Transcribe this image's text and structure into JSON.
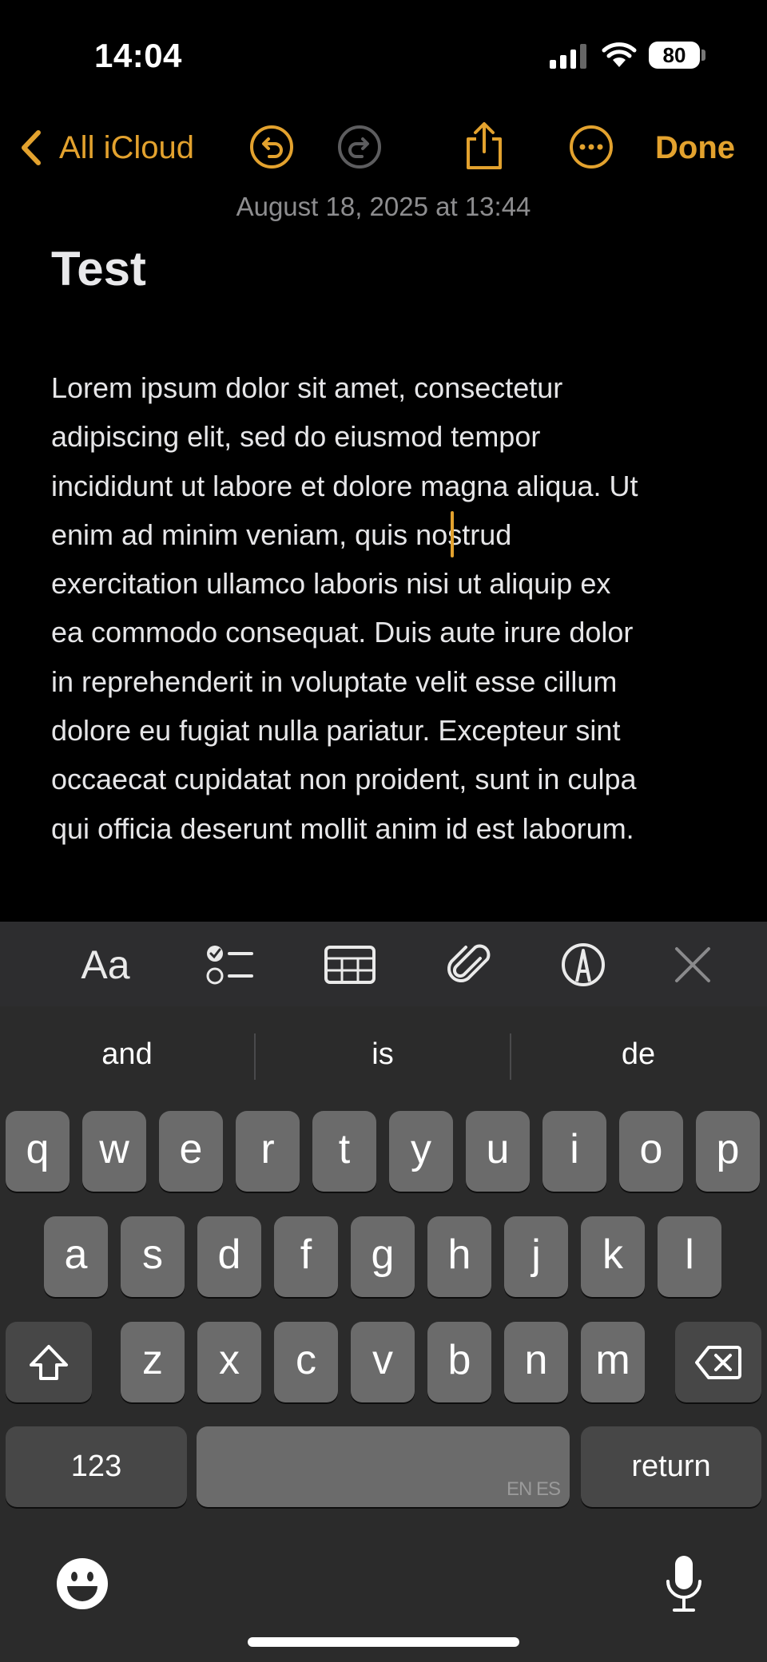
{
  "status_bar": {
    "time": "14:04",
    "battery": "80",
    "signal_icon": "cellular-signal-icon",
    "wifi_icon": "wifi-icon"
  },
  "nav": {
    "back_label": "All iCloud",
    "done_label": "Done",
    "icons": [
      "chevron-left-icon",
      "undo-icon",
      "redo-icon",
      "share-icon",
      "more-icon"
    ],
    "accent": "#e3a22e"
  },
  "note": {
    "date": "August 18, 2025 at 13:44",
    "title": "Test",
    "body": "Lorem ipsum dolor sit amet, consectetur\nadipiscing elit, sed do eiusmod tempor\nincididunt ut labore et dolore magna aliqua. Ut\nenim ad minim veniam, quis nostrud\nexercitation ullamco laboris nisi ut aliquip ex\nea commodo consequat. Duis aute irure dolor\nin reprehenderit in voluptate velit esse cillum\ndolore eu fugiat nulla pariatur. Excepteur sint\noccaecat cupidatat non proident, sunt in culpa\nqui officia deserunt mollit anim id est laborum."
  },
  "toolbar": {
    "format_label": "Aa",
    "icons": [
      "text-format-icon",
      "checklist-icon",
      "table-icon",
      "attachment-icon",
      "markup-icon",
      "close-icon"
    ]
  },
  "keyboard": {
    "suggestions": [
      "and",
      "is",
      "de"
    ],
    "row1": [
      "q",
      "w",
      "e",
      "r",
      "t",
      "y",
      "u",
      "i",
      "o",
      "p"
    ],
    "row2": [
      "a",
      "s",
      "d",
      "f",
      "g",
      "h",
      "j",
      "k",
      "l"
    ],
    "row3": [
      "z",
      "x",
      "c",
      "v",
      "b",
      "n",
      "m"
    ],
    "numbers_label": "123",
    "return_label": "return",
    "space_lang": "EN ES",
    "icons": [
      "shift-icon",
      "delete-icon",
      "emoji-icon",
      "microphone-icon"
    ]
  }
}
